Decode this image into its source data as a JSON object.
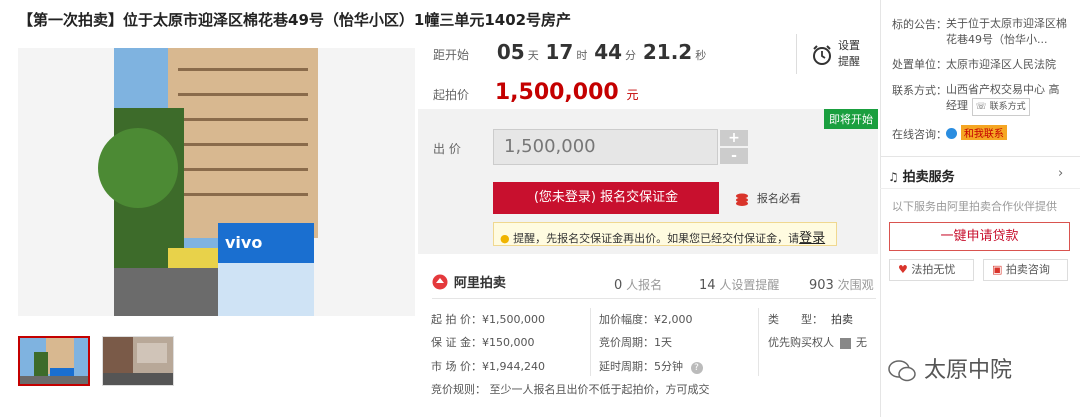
{
  "title": "【第一次拍卖】位于太原市迎泽区棉花巷49号（怡华小区）1幢三单元1402号房产",
  "countdown": {
    "label": "距开始",
    "days": "05",
    "days_unit": "天",
    "hours": "17",
    "hours_unit": "时",
    "minutes": "44",
    "minutes_unit": "分",
    "seconds": "21.2",
    "seconds_unit": "秒",
    "remind": "设置提醒"
  },
  "start_price": {
    "label": "起拍价",
    "value": "1,500,000",
    "unit": "元"
  },
  "bid": {
    "badge": "即将开始",
    "label": "出 价",
    "value": "1,500,000",
    "plus": "+",
    "minus": "-",
    "signup_button": "(您未登录) 报名交保证金",
    "must_read": "报名必看",
    "notice_text": "提醒，先报名交保证金再出价。如果您已经交付保证金，请",
    "notice_login": "登录"
  },
  "stats": {
    "brand": "阿里拍卖",
    "signups": "0",
    "signups_label": "人报名",
    "reminders": "14",
    "reminders_label": "人设置提醒",
    "views": "903",
    "views_label": "次围观"
  },
  "details": {
    "start_price": "起 拍 价：¥1,500,000",
    "deposit": "保 证 金：¥150,000",
    "market_price": "市 场 价：¥1,944,240",
    "increment": "加价幅度：¥2,000",
    "cycle": "竞价周期：1天",
    "delay": "延时周期：5分钟",
    "type_label": "类　　型：",
    "type_value": "拍卖",
    "priority_label": "优先购买权人",
    "priority_value": "无",
    "rule": "竞价规则：  至少一人报名且出价不低于起拍价，方可成交"
  },
  "sidebar": {
    "notice_label": "标的公告：",
    "notice_value": "关于位于太原市迎泽区棉花巷49号（怡华小...",
    "unit_label": "处置单位：",
    "unit_value": "太原市迎泽区人民法院",
    "contact_label": "联系方式：",
    "contact_value": "山西省产权交易中心 高经理",
    "tel_tag": "联系方式",
    "consult_label": "在线咨询：",
    "consult_tag": "和我联系",
    "service_title": "拍卖服务",
    "service_desc": "以下服务由阿里拍卖合作伙伴提供",
    "loan_button": "一键申请贷款",
    "law_button": "法拍无忧",
    "consult_button": "拍卖咨询",
    "watermark": "太原中院"
  }
}
